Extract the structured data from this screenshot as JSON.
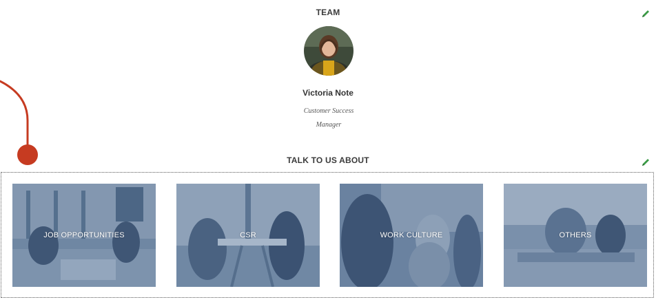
{
  "team": {
    "title": "TEAM",
    "member": {
      "name": "Victoria Note",
      "role_line1": "Customer Success",
      "role_line2": "Manager"
    }
  },
  "talk": {
    "title": "TALK TO US ABOUT",
    "cards": [
      {
        "label": "JOB OPPORTUNITIES"
      },
      {
        "label": "CSR"
      },
      {
        "label": "WORK CULTURE"
      },
      {
        "label": "OTHERS"
      }
    ]
  },
  "icons": {
    "edit": "pencil-icon",
    "annotation": "pointer-annotation"
  },
  "colors": {
    "edit_icon": "#3a9a45",
    "annotation": "#c63b21",
    "card_tint": "#5b7594"
  }
}
